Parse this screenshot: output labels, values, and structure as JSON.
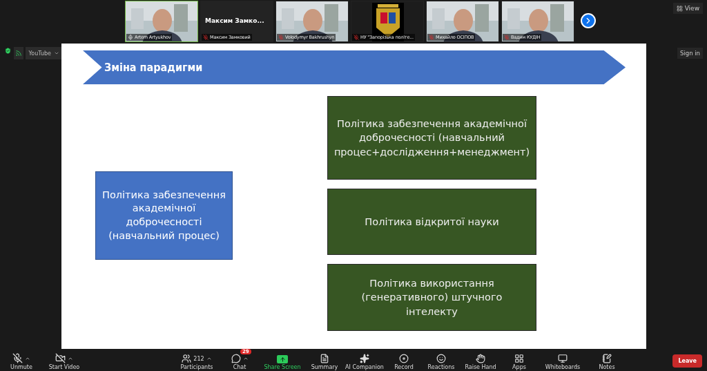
{
  "gallery": {
    "tiles": [
      {
        "kind": "video",
        "name": "Artem Artyukhov",
        "muted": false,
        "active": true
      },
      {
        "kind": "name",
        "display": "Максим  Замко...",
        "name": "Максим Замковий",
        "muted": true,
        "active": false
      },
      {
        "kind": "video",
        "name": "Volodymyr Bakhrushyn",
        "muted": true,
        "active": false
      },
      {
        "kind": "logo",
        "name": "НУ \"Запорізька політе...",
        "muted": true,
        "active": false
      },
      {
        "kind": "video",
        "name": "Михайло ОСІПОВ",
        "muted": true,
        "active": false
      },
      {
        "kind": "video",
        "name": "Вадим КУДІН",
        "muted": true,
        "active": false
      }
    ]
  },
  "view_button": "View",
  "stream": {
    "source": "YouTube"
  },
  "sign_in": "Sign in",
  "slide": {
    "title": "Зміна парадигми",
    "left_box": "Політика забезпечення академічної доброчесності (навчальний процес)",
    "right_boxes": [
      "Політика забезпечення академічної доброчесності (навчальний процес+дослідження+менеджмент)",
      "Політика відкритої науки",
      "Політика використання (генеративного) штучного інтелекту"
    ]
  },
  "toolbar": {
    "left": [
      {
        "kind": "mic",
        "label": "Unmute",
        "off": true
      },
      {
        "kind": "camera",
        "label": "Start Video",
        "off": true
      }
    ],
    "center": [
      {
        "kind": "participants",
        "label": "Participants",
        "count": "212"
      },
      {
        "kind": "chat",
        "label": "Chat",
        "badge": "29"
      },
      {
        "kind": "share",
        "label": "Share Screen"
      },
      {
        "kind": "summary",
        "label": "Summary"
      },
      {
        "kind": "ai",
        "label": "AI Companion"
      },
      {
        "kind": "record",
        "label": "Record"
      },
      {
        "kind": "reactions",
        "label": "Reactions"
      },
      {
        "kind": "hand",
        "label": "Raise Hand"
      },
      {
        "kind": "apps",
        "label": "Apps"
      },
      {
        "kind": "whiteboards",
        "label": "Whiteboards"
      },
      {
        "kind": "notes",
        "label": "Notes"
      }
    ],
    "leave": "Leave"
  }
}
